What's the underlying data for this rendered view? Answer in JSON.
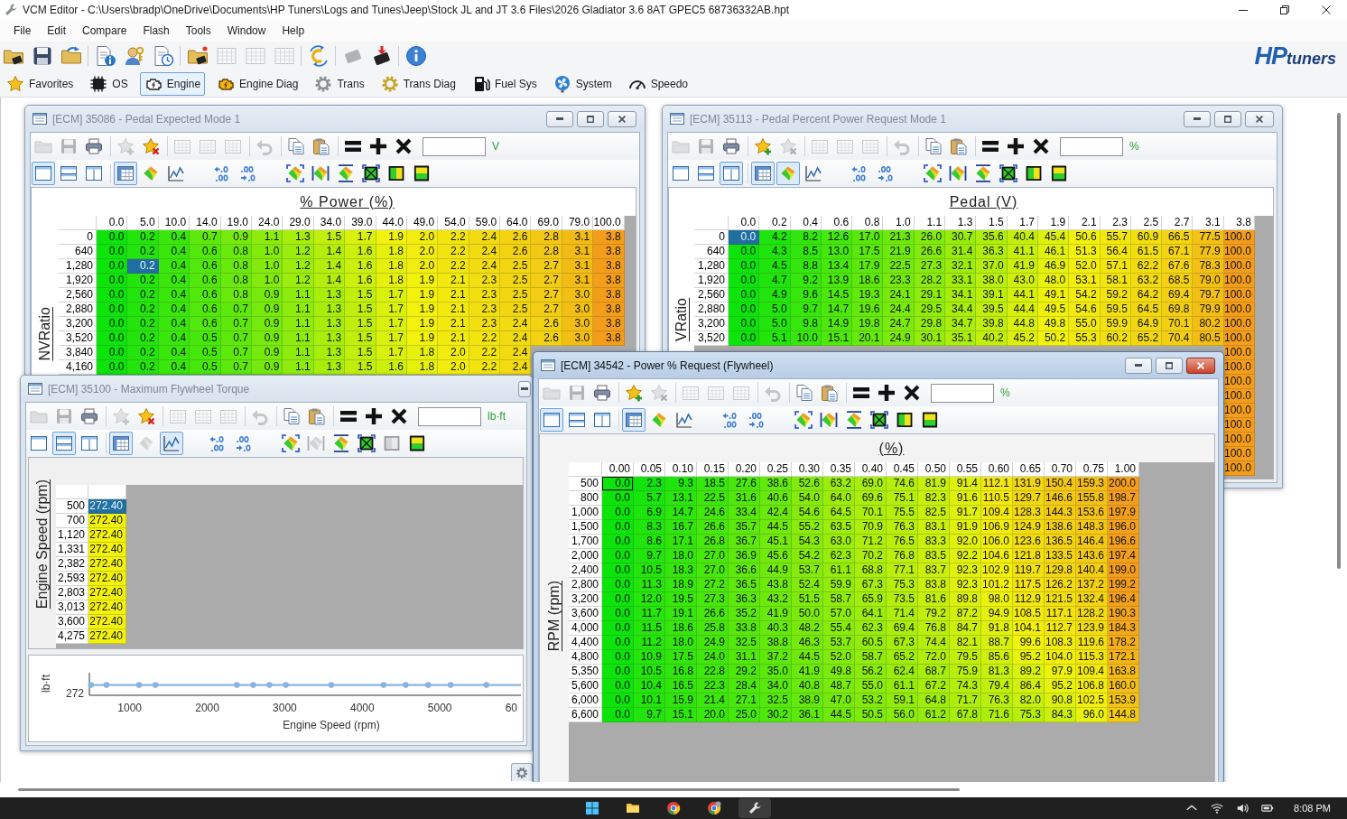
{
  "window": {
    "title": "VCM Editor - C:\\Users\\bradp\\OneDrive\\Documents\\HP Tuners\\Logs and Tunes\\Jeep\\Stock JL and JT 3.6 Files\\2026 Gladiator 3.6 8AT GPEC5 68736332AB.hpt"
  },
  "menu": [
    "File",
    "Edit",
    "Compare",
    "Flash",
    "Tools",
    "Window",
    "Help"
  ],
  "main_toolbar": [
    {
      "kind": "open-file",
      "disabled": false
    },
    {
      "kind": "save",
      "disabled": false
    },
    {
      "kind": "open-folder",
      "disabled": false
    },
    {
      "kind": "file-info",
      "disabled": false
    },
    {
      "kind": "user-key",
      "disabled": false
    },
    {
      "kind": "file-history",
      "disabled": false
    },
    {
      "kind": "open-device",
      "disabled": false
    },
    {
      "kind": "table",
      "disabled": true
    },
    {
      "kind": "table",
      "disabled": true
    },
    {
      "kind": "table",
      "disabled": true
    },
    {
      "kind": "compare",
      "disabled": false
    },
    {
      "kind": "chip-read",
      "disabled": true
    },
    {
      "kind": "chip-write",
      "disabled": false
    },
    {
      "kind": "info",
      "disabled": false
    }
  ],
  "logo": {
    "initials": "HP",
    "word": "tuners"
  },
  "nav_tabs": [
    {
      "kind": "favorites",
      "label": "Favorites",
      "selected": false
    },
    {
      "kind": "os",
      "label": "OS",
      "selected": false
    },
    {
      "kind": "engine",
      "label": "Engine",
      "selected": true
    },
    {
      "kind": "engine-diag",
      "label": "Engine Diag",
      "selected": false
    },
    {
      "kind": "trans",
      "label": "Trans",
      "selected": false
    },
    {
      "kind": "trans-diag",
      "label": "Trans Diag",
      "selected": false
    },
    {
      "kind": "fuel",
      "label": "Fuel Sys",
      "selected": false
    },
    {
      "kind": "system",
      "label": "System",
      "selected": false
    },
    {
      "kind": "speedo",
      "label": "Speedo",
      "selected": false
    }
  ],
  "editor_windows": [
    {
      "kind": "map",
      "title": "[ECM] 35086 - Pedal Expected Mode 1",
      "active": false,
      "toolbar": [
        {
          "kind": "open",
          "disabled": true
        },
        {
          "kind": "save",
          "disabled": true
        },
        {
          "kind": "print",
          "disabled": false
        },
        {
          "kind": "favorite-add",
          "disabled": true
        },
        {
          "kind": "favorite-remove",
          "disabled": false
        },
        {
          "kind": "grid",
          "disabled": true
        },
        {
          "kind": "grid",
          "disabled": true
        },
        {
          "kind": "grid",
          "disabled": true
        },
        {
          "kind": "undo",
          "disabled": true
        },
        {
          "kind": "copy",
          "disabled": false
        },
        {
          "kind": "paste",
          "disabled": false
        },
        {
          "kind": "set",
          "disabled": false
        },
        {
          "kind": "add",
          "disabled": false
        },
        {
          "kind": "multiply",
          "disabled": false
        }
      ],
      "unit": "V",
      "view_toolbar": [
        {
          "kind": "single-view",
          "pressed": true,
          "disabled": false
        },
        {
          "kind": "horizontal-split",
          "pressed": false,
          "disabled": false
        },
        {
          "kind": "vertical-split",
          "pressed": false,
          "disabled": false
        },
        {
          "kind": "table-view",
          "pressed": true,
          "disabled": false
        },
        {
          "kind": "surface-view",
          "pressed": false,
          "disabled": false
        },
        {
          "kind": "graph-view",
          "pressed": false,
          "disabled": false
        },
        {
          "kind": "decimals-fewer",
          "pressed": false,
          "disabled": false
        },
        {
          "kind": "decimals-more",
          "pressed": false,
          "disabled": false
        },
        {
          "kind": "smooth",
          "pressed": false,
          "disabled": false
        },
        {
          "kind": "interpolate-horizontal",
          "pressed": false,
          "disabled": false
        },
        {
          "kind": "interpolate-vertical",
          "pressed": false,
          "disabled": false
        },
        {
          "kind": "fill",
          "pressed": false,
          "disabled": false
        },
        {
          "kind": "interpolate-columns",
          "pressed": false,
          "disabled": false
        },
        {
          "kind": "interpolate-rows",
          "pressed": false,
          "disabled": false
        }
      ],
      "column_axis_title": "% Power (%)",
      "row_axis_title": "NVRatio",
      "columns": [
        {
          "label": "0.0",
          "selected": false
        },
        {
          "label": "5.0",
          "selected": true
        },
        {
          "label": "10.0",
          "selected": false
        },
        {
          "label": "14.0",
          "selected": false
        },
        {
          "label": "19.0",
          "selected": false
        },
        {
          "label": "24.0",
          "selected": false
        },
        {
          "label": "29.0",
          "selected": false
        },
        {
          "label": "34.0",
          "selected": false
        },
        {
          "label": "39.0",
          "selected": false
        },
        {
          "label": "44.0",
          "selected": false
        },
        {
          "label": "49.0",
          "selected": false
        },
        {
          "label": "54.0",
          "selected": false
        },
        {
          "label": "59.0",
          "selected": false
        },
        {
          "label": "64.0",
          "selected": false
        },
        {
          "label": "69.0",
          "selected": false
        },
        {
          "label": "79.0",
          "selected": false
        },
        {
          "label": "100.0",
          "selected": false
        }
      ],
      "rows": [
        {
          "label": "0",
          "selected": false,
          "cells": [
            "0.0",
            "0.2",
            "0.4",
            "0.7",
            "0.9",
            "1.1",
            "1.3",
            "1.5",
            "1.7",
            "1.9",
            "2.0",
            "2.2",
            "2.4",
            "2.6",
            "2.8",
            "3.1",
            "3.8"
          ]
        },
        {
          "label": "640",
          "selected": false,
          "cells": [
            "0.0",
            "0.2",
            "0.4",
            "0.6",
            "0.8",
            "1.0",
            "1.2",
            "1.4",
            "1.6",
            "1.8",
            "2.0",
            "2.2",
            "2.4",
            "2.6",
            "2.8",
            "3.1",
            "3.8"
          ]
        },
        {
          "label": "1,280",
          "selected": true,
          "cells": [
            "0.0",
            "0.2",
            "0.4",
            "0.6",
            "0.8",
            "1.0",
            "1.2",
            "1.4",
            "1.6",
            "1.8",
            "2.0",
            "2.2",
            "2.4",
            "2.5",
            "2.7",
            "3.1",
            "3.8"
          ]
        },
        {
          "label": "1,920",
          "selected": false,
          "cells": [
            "0.0",
            "0.2",
            "0.4",
            "0.6",
            "0.8",
            "1.0",
            "1.2",
            "1.4",
            "1.6",
            "1.8",
            "1.9",
            "2.1",
            "2.3",
            "2.5",
            "2.7",
            "3.1",
            "3.8"
          ]
        },
        {
          "label": "2,560",
          "selected": false,
          "cells": [
            "0.0",
            "0.2",
            "0.4",
            "0.6",
            "0.8",
            "0.9",
            "1.1",
            "1.3",
            "1.5",
            "1.7",
            "1.9",
            "2.1",
            "2.3",
            "2.5",
            "2.7",
            "3.0",
            "3.8"
          ]
        },
        {
          "label": "2,880",
          "selected": false,
          "cells": [
            "0.0",
            "0.2",
            "0.4",
            "0.6",
            "0.7",
            "0.9",
            "1.1",
            "1.3",
            "1.5",
            "1.7",
            "1.9",
            "2.1",
            "2.3",
            "2.5",
            "2.7",
            "3.0",
            "3.8"
          ]
        },
        {
          "label": "3,200",
          "selected": false,
          "cells": [
            "0.0",
            "0.2",
            "0.4",
            "0.6",
            "0.7",
            "0.9",
            "1.1",
            "1.3",
            "1.5",
            "1.7",
            "1.9",
            "2.1",
            "2.3",
            "2.4",
            "2.6",
            "3.0",
            "3.8"
          ]
        },
        {
          "label": "3,520",
          "selected": false,
          "cells": [
            "0.0",
            "0.2",
            "0.4",
            "0.5",
            "0.7",
            "0.9",
            "1.1",
            "1.3",
            "1.5",
            "1.7",
            "1.9",
            "2.1",
            "2.2",
            "2.4",
            "2.6",
            "3.0",
            "3.8"
          ]
        },
        {
          "label": "3,840",
          "selected": false,
          "cells": [
            "0.0",
            "0.2",
            "0.4",
            "0.5",
            "0.7",
            "0.9",
            "1.1",
            "1.3",
            "1.5",
            "1.7",
            "1.8",
            "2.0",
            "2.2",
            "2.4"
          ]
        },
        {
          "label": "4,160",
          "selected": false,
          "cells": [
            "0.0",
            "0.2",
            "0.4",
            "0.5",
            "0.7",
            "0.9",
            "1.1",
            "1.3",
            "1.5",
            "1.6",
            "1.8",
            "2.0",
            "2.2",
            "2.4"
          ]
        }
      ]
    },
    {
      "kind": "map",
      "title": "[ECM] 35113 - Pedal Percent Power Request Mode 1",
      "active": false,
      "toolbar": [
        {
          "kind": "open",
          "disabled": true
        },
        {
          "kind": "save",
          "disabled": true
        },
        {
          "kind": "print",
          "disabled": false
        },
        {
          "kind": "favorite-add",
          "disabled": false
        },
        {
          "kind": "favorite-remove",
          "disabled": true
        },
        {
          "kind": "grid",
          "disabled": true
        },
        {
          "kind": "grid",
          "disabled": true
        },
        {
          "kind": "grid",
          "disabled": true
        },
        {
          "kind": "undo",
          "disabled": true
        },
        {
          "kind": "copy",
          "disabled": false
        },
        {
          "kind": "paste",
          "disabled": false
        },
        {
          "kind": "set",
          "disabled": false
        },
        {
          "kind": "add",
          "disabled": false
        },
        {
          "kind": "multiply",
          "disabled": false
        }
      ],
      "unit": "%",
      "view_toolbar": [
        {
          "kind": "single-view",
          "pressed": false,
          "disabled": false
        },
        {
          "kind": "horizontal-split",
          "pressed": false,
          "disabled": false
        },
        {
          "kind": "vertical-split",
          "pressed": true,
          "disabled": false
        },
        {
          "kind": "table-view",
          "pressed": true,
          "disabled": false
        },
        {
          "kind": "surface-view",
          "pressed": true,
          "disabled": false
        },
        {
          "kind": "graph-view",
          "pressed": false,
          "disabled": false
        },
        {
          "kind": "decimals-fewer",
          "pressed": false,
          "disabled": false
        },
        {
          "kind": "decimals-more",
          "pressed": false,
          "disabled": false
        },
        {
          "kind": "smooth",
          "pressed": false,
          "disabled": false
        },
        {
          "kind": "interpolate-horizontal",
          "pressed": false,
          "disabled": false
        },
        {
          "kind": "interpolate-vertical",
          "pressed": false,
          "disabled": false
        },
        {
          "kind": "fill",
          "pressed": false,
          "disabled": false
        },
        {
          "kind": "interpolate-columns",
          "pressed": false,
          "disabled": false
        },
        {
          "kind": "interpolate-rows",
          "pressed": false,
          "disabled": false
        }
      ],
      "column_axis_title": "Pedal (V)",
      "row_axis_title": "VRatio",
      "columns": [
        {
          "label": "0.0",
          "selected": true
        },
        {
          "label": "0.2",
          "selected": false
        },
        {
          "label": "0.4",
          "selected": false
        },
        {
          "label": "0.6",
          "selected": false
        },
        {
          "label": "0.8",
          "selected": false
        },
        {
          "label": "1.0",
          "selected": false
        },
        {
          "label": "1.1",
          "selected": false
        },
        {
          "label": "1.3",
          "selected": false
        },
        {
          "label": "1.5",
          "selected": false
        },
        {
          "label": "1.7",
          "selected": false
        },
        {
          "label": "1.9",
          "selected": false
        },
        {
          "label": "2.1",
          "selected": false
        },
        {
          "label": "2.3",
          "selected": false
        },
        {
          "label": "2.5",
          "selected": false
        },
        {
          "label": "2.7",
          "selected": false
        },
        {
          "label": "3.1",
          "selected": false
        },
        {
          "label": "3.8",
          "selected": false
        }
      ],
      "rows": [
        {
          "label": "0",
          "selected": true,
          "cells": [
            "0.0",
            "4.2",
            "8.2",
            "12.6",
            "17.0",
            "21.3",
            "26.0",
            "30.7",
            "35.6",
            "40.4",
            "45.4",
            "50.6",
            "55.7",
            "60.9",
            "66.5",
            "77.5",
            "100.0"
          ]
        },
        {
          "label": "640",
          "selected": false,
          "cells": [
            "0.0",
            "4.3",
            "8.5",
            "13.0",
            "17.5",
            "21.9",
            "26.6",
            "31.4",
            "36.3",
            "41.1",
            "46.1",
            "51.3",
            "56.4",
            "61.5",
            "67.1",
            "77.9",
            "100.0"
          ]
        },
        {
          "label": "1,280",
          "selected": false,
          "cells": [
            "0.0",
            "4.5",
            "8.8",
            "13.4",
            "17.9",
            "22.5",
            "27.3",
            "32.1",
            "37.0",
            "41.9",
            "46.9",
            "52.0",
            "57.1",
            "62.2",
            "67.6",
            "78.3",
            "100.0"
          ]
        },
        {
          "label": "1,920",
          "selected": false,
          "cells": [
            "0.0",
            "4.7",
            "9.2",
            "13.9",
            "18.6",
            "23.3",
            "28.2",
            "33.1",
            "38.0",
            "43.0",
            "48.0",
            "53.1",
            "58.1",
            "63.2",
            "68.5",
            "79.0",
            "100.0"
          ]
        },
        {
          "label": "2,560",
          "selected": false,
          "cells": [
            "0.0",
            "4.9",
            "9.6",
            "14.5",
            "19.3",
            "24.1",
            "29.1",
            "34.1",
            "39.1",
            "44.1",
            "49.1",
            "54.2",
            "59.2",
            "64.2",
            "69.4",
            "79.7",
            "100.0"
          ]
        },
        {
          "label": "2,880",
          "selected": false,
          "cells": [
            "0.0",
            "5.0",
            "9.7",
            "14.7",
            "19.6",
            "24.4",
            "29.5",
            "34.4",
            "39.5",
            "44.4",
            "49.5",
            "54.6",
            "59.5",
            "64.5",
            "69.8",
            "79.9",
            "100.0"
          ]
        },
        {
          "label": "3,200",
          "selected": false,
          "cells": [
            "0.0",
            "5.0",
            "9.8",
            "14.9",
            "19.8",
            "24.7",
            "29.8",
            "34.7",
            "39.8",
            "44.8",
            "49.8",
            "55.0",
            "59.9",
            "64.9",
            "70.1",
            "80.2",
            "100.0"
          ]
        },
        {
          "label": "3,520",
          "selected": false,
          "cells": [
            "0.0",
            "5.1",
            "10.0",
            "15.1",
            "20.1",
            "24.9",
            "30.1",
            "35.1",
            "40.2",
            "45.2",
            "50.2",
            "55.3",
            "60.2",
            "65.2",
            "70.4",
            "80.5",
            "100.0"
          ]
        }
      ],
      "covered_rows_last_column": [
        "100.0",
        "100.0",
        "100.0",
        "100.0",
        "100.0",
        "100.0",
        "100.0",
        "100.0",
        "100.0"
      ]
    },
    {
      "kind": "curve",
      "title": "[ECM] 35100 - Maximum Flywheel Torque",
      "active": false,
      "toolbar": [
        {
          "kind": "open",
          "disabled": true
        },
        {
          "kind": "save",
          "disabled": true
        },
        {
          "kind": "print",
          "disabled": false
        },
        {
          "kind": "favorite-add",
          "disabled": true
        },
        {
          "kind": "favorite-remove",
          "disabled": false
        },
        {
          "kind": "grid",
          "disabled": true
        },
        {
          "kind": "grid",
          "disabled": true
        },
        {
          "kind": "grid",
          "disabled": true
        },
        {
          "kind": "undo",
          "disabled": true
        },
        {
          "kind": "copy",
          "disabled": false
        },
        {
          "kind": "paste",
          "disabled": false
        },
        {
          "kind": "set",
          "disabled": false
        },
        {
          "kind": "add",
          "disabled": false
        },
        {
          "kind": "multiply",
          "disabled": false
        }
      ],
      "unit": "lb·ft",
      "view_toolbar": [
        {
          "kind": "single-view",
          "pressed": false,
          "disabled": false
        },
        {
          "kind": "horizontal-split",
          "pressed": true,
          "disabled": false
        },
        {
          "kind": "vertical-split",
          "pressed": false,
          "disabled": false
        },
        {
          "kind": "table-view",
          "pressed": true,
          "disabled": false
        },
        {
          "kind": "surface-view",
          "pressed": false,
          "disabled": true
        },
        {
          "kind": "graph-view",
          "pressed": true,
          "disabled": false
        },
        {
          "kind": "decimals-fewer",
          "pressed": false,
          "disabled": false
        },
        {
          "kind": "decimals-more",
          "pressed": false,
          "disabled": false
        },
        {
          "kind": "smooth",
          "pressed": false,
          "disabled": false
        },
        {
          "kind": "interpolate-horizontal",
          "pressed": false,
          "disabled": true
        },
        {
          "kind": "interpolate-vertical",
          "pressed": false,
          "disabled": false
        },
        {
          "kind": "fill",
          "pressed": false,
          "disabled": false
        },
        {
          "kind": "interpolate-columns",
          "pressed": false,
          "disabled": true
        },
        {
          "kind": "interpolate-rows",
          "pressed": false,
          "disabled": false
        }
      ],
      "row_axis_title": "Engine Speed (rpm)",
      "rows": [
        {
          "label": "500",
          "value": "272.40",
          "selected": true
        },
        {
          "label": "700",
          "value": "272.40",
          "selected": false
        },
        {
          "label": "1,120",
          "value": "272.40",
          "selected": false
        },
        {
          "label": "1,331",
          "value": "272.40",
          "selected": false
        },
        {
          "label": "2,382",
          "value": "272.40",
          "selected": false
        },
        {
          "label": "2,593",
          "value": "272.40",
          "selected": false
        },
        {
          "label": "2,803",
          "value": "272.40",
          "selected": false
        },
        {
          "label": "3,013",
          "value": "272.40",
          "selected": false
        },
        {
          "label": "3,600",
          "value": "272.40",
          "selected": false
        },
        {
          "label": "4,275",
          "value": "272.40",
          "selected": false
        }
      ],
      "graph": {
        "y_title": "lb·ft",
        "y_label": "272",
        "x_labels": [
          "1000",
          "2000",
          "3000",
          "4000",
          "5000",
          "60"
        ],
        "x_title": "Engine Speed (rpm)"
      }
    },
    {
      "kind": "map",
      "title": "[ECM] 34542 - Power % Request (Flywheel)",
      "active": true,
      "toolbar": [
        {
          "kind": "open",
          "disabled": true
        },
        {
          "kind": "save",
          "disabled": true
        },
        {
          "kind": "print",
          "disabled": false
        },
        {
          "kind": "favorite-add",
          "disabled": false
        },
        {
          "kind": "favorite-remove",
          "disabled": true
        },
        {
          "kind": "grid",
          "disabled": true
        },
        {
          "kind": "grid",
          "disabled": true
        },
        {
          "kind": "grid",
          "disabled": true
        },
        {
          "kind": "undo",
          "disabled": true
        },
        {
          "kind": "copy",
          "disabled": false
        },
        {
          "kind": "paste",
          "disabled": false
        },
        {
          "kind": "set",
          "disabled": false
        },
        {
          "kind": "add",
          "disabled": false
        },
        {
          "kind": "multiply",
          "disabled": false
        }
      ],
      "unit": "%",
      "view_toolbar": [
        {
          "kind": "single-view",
          "pressed": true,
          "disabled": false
        },
        {
          "kind": "horizontal-split",
          "pressed": false,
          "disabled": false
        },
        {
          "kind": "vertical-split",
          "pressed": false,
          "disabled": false
        },
        {
          "kind": "table-view",
          "pressed": true,
          "disabled": false
        },
        {
          "kind": "surface-view",
          "pressed": false,
          "disabled": false
        },
        {
          "kind": "graph-view",
          "pressed": false,
          "disabled": false
        },
        {
          "kind": "decimals-fewer",
          "pressed": false,
          "disabled": false
        },
        {
          "kind": "decimals-more",
          "pressed": false,
          "disabled": false
        },
        {
          "kind": "smooth",
          "pressed": false,
          "disabled": false
        },
        {
          "kind": "interpolate-horizontal",
          "pressed": false,
          "disabled": false
        },
        {
          "kind": "interpolate-vertical",
          "pressed": false,
          "disabled": false
        },
        {
          "kind": "fill",
          "pressed": false,
          "disabled": false
        },
        {
          "kind": "interpolate-columns",
          "pressed": false,
          "disabled": false
        },
        {
          "kind": "interpolate-rows",
          "pressed": false,
          "disabled": false
        }
      ],
      "column_axis_title": "(%)",
      "row_axis_title": "RPM (rpm)",
      "columns": [
        {
          "label": "0.00",
          "selected": true
        },
        {
          "label": "0.05",
          "selected": false
        },
        {
          "label": "0.10",
          "selected": false
        },
        {
          "label": "0.15",
          "selected": false
        },
        {
          "label": "0.20",
          "selected": false
        },
        {
          "label": "0.25",
          "selected": false
        },
        {
          "label": "0.30",
          "selected": false
        },
        {
          "label": "0.35",
          "selected": false
        },
        {
          "label": "0.40",
          "selected": false
        },
        {
          "label": "0.45",
          "selected": false
        },
        {
          "label": "0.50",
          "selected": false
        },
        {
          "label": "0.55",
          "selected": false
        },
        {
          "label": "0.60",
          "selected": false
        },
        {
          "label": "0.65",
          "selected": false
        },
        {
          "label": "0.70",
          "selected": false
        },
        {
          "label": "0.75",
          "selected": false
        },
        {
          "label": "1.00",
          "selected": false
        }
      ],
      "rows": [
        {
          "label": "500",
          "selected": true,
          "cells": [
            "0.0",
            "2.3",
            "9.3",
            "18.5",
            "27.6",
            "38.6",
            "52.6",
            "63.2",
            "69.0",
            "74.6",
            "81.9",
            "91.4",
            "112.1",
            "131.9",
            "150.4",
            "159.3",
            "200.0"
          ]
        },
        {
          "label": "800",
          "selected": false,
          "cells": [
            "0.0",
            "5.7",
            "13.1",
            "22.5",
            "31.6",
            "40.6",
            "54.0",
            "64.0",
            "69.6",
            "75.1",
            "82.3",
            "91.6",
            "110.5",
            "129.7",
            "146.6",
            "155.8",
            "198.7"
          ]
        },
        {
          "label": "1,000",
          "selected": false,
          "cells": [
            "0.0",
            "6.9",
            "14.7",
            "24.6",
            "33.4",
            "42.4",
            "54.6",
            "64.5",
            "70.1",
            "75.5",
            "82.5",
            "91.7",
            "109.4",
            "128.3",
            "144.3",
            "153.6",
            "197.9"
          ]
        },
        {
          "label": "1,500",
          "selected": false,
          "cells": [
            "0.0",
            "8.3",
            "16.7",
            "26.6",
            "35.7",
            "44.5",
            "55.2",
            "63.5",
            "70.9",
            "76.3",
            "83.1",
            "91.9",
            "106.9",
            "124.9",
            "138.6",
            "148.3",
            "196.0"
          ]
        },
        {
          "label": "1,700",
          "selected": false,
          "cells": [
            "0.0",
            "8.6",
            "17.1",
            "26.8",
            "36.7",
            "45.1",
            "54.3",
            "63.0",
            "71.2",
            "76.5",
            "83.3",
            "92.0",
            "106.0",
            "123.6",
            "136.5",
            "146.4",
            "196.6"
          ]
        },
        {
          "label": "2,000",
          "selected": false,
          "cells": [
            "0.0",
            "9.7",
            "18.0",
            "27.0",
            "36.9",
            "45.6",
            "54.2",
            "62.3",
            "70.2",
            "76.8",
            "83.5",
            "92.2",
            "104.6",
            "121.8",
            "133.5",
            "143.6",
            "197.4"
          ]
        },
        {
          "label": "2,400",
          "selected": false,
          "cells": [
            "0.0",
            "10.5",
            "18.3",
            "27.0",
            "36.6",
            "44.9",
            "53.7",
            "61.1",
            "68.8",
            "77.1",
            "83.7",
            "92.3",
            "102.9",
            "119.7",
            "129.8",
            "140.4",
            "199.0"
          ]
        },
        {
          "label": "2,800",
          "selected": false,
          "cells": [
            "0.0",
            "11.3",
            "18.9",
            "27.2",
            "36.5",
            "43.8",
            "52.4",
            "59.9",
            "67.3",
            "75.3",
            "83.8",
            "92.3",
            "101.2",
            "117.5",
            "126.2",
            "137.2",
            "199.2"
          ]
        },
        {
          "label": "3,200",
          "selected": false,
          "cells": [
            "0.0",
            "12.0",
            "19.5",
            "27.3",
            "36.3",
            "43.2",
            "51.5",
            "58.7",
            "65.9",
            "73.5",
            "81.6",
            "89.8",
            "98.0",
            "112.9",
            "121.5",
            "132.4",
            "196.4"
          ]
        },
        {
          "label": "3,600",
          "selected": false,
          "cells": [
            "0.0",
            "11.7",
            "19.1",
            "26.6",
            "35.2",
            "41.9",
            "50.0",
            "57.0",
            "64.1",
            "71.4",
            "79.2",
            "87.2",
            "94.9",
            "108.5",
            "117.1",
            "128.2",
            "190.3"
          ]
        },
        {
          "label": "4,000",
          "selected": false,
          "cells": [
            "0.0",
            "11.5",
            "18.6",
            "25.8",
            "33.8",
            "40.3",
            "48.2",
            "55.4",
            "62.3",
            "69.4",
            "76.8",
            "84.7",
            "91.8",
            "104.1",
            "112.7",
            "123.9",
            "184.3"
          ]
        },
        {
          "label": "4,400",
          "selected": false,
          "cells": [
            "0.0",
            "11.2",
            "18.0",
            "24.9",
            "32.5",
            "38.8",
            "46.3",
            "53.7",
            "60.5",
            "67.3",
            "74.4",
            "82.1",
            "88.7",
            "99.6",
            "108.3",
            "119.6",
            "178.2"
          ]
        },
        {
          "label": "4,800",
          "selected": false,
          "cells": [
            "0.0",
            "10.9",
            "17.5",
            "24.0",
            "31.1",
            "37.2",
            "44.5",
            "52.0",
            "58.7",
            "65.2",
            "72.0",
            "79.5",
            "85.6",
            "95.2",
            "104.0",
            "115.3",
            "172.1"
          ]
        },
        {
          "label": "5,350",
          "selected": false,
          "cells": [
            "0.0",
            "10.5",
            "16.8",
            "22.8",
            "29.2",
            "35.0",
            "41.9",
            "49.8",
            "56.2",
            "62.4",
            "68.7",
            "75.9",
            "81.3",
            "89.2",
            "97.9",
            "109.4",
            "163.8"
          ]
        },
        {
          "label": "5,600",
          "selected": false,
          "cells": [
            "0.0",
            "10.4",
            "16.5",
            "22.3",
            "28.4",
            "34.0",
            "40.8",
            "48.7",
            "55.0",
            "61.1",
            "67.2",
            "74.3",
            "79.4",
            "86.4",
            "95.2",
            "106.8",
            "160.0"
          ]
        },
        {
          "label": "6,000",
          "selected": false,
          "cells": [
            "0.0",
            "10.1",
            "15.9",
            "21.4",
            "27.1",
            "32.5",
            "38.9",
            "47.0",
            "53.2",
            "59.1",
            "64.8",
            "71.7",
            "76.3",
            "82.0",
            "90.8",
            "102.5",
            "153.9"
          ]
        },
        {
          "label": "6,600",
          "selected": false,
          "cells": [
            "0.0",
            "9.7",
            "15.1",
            "20.0",
            "25.0",
            "30.2",
            "36.1",
            "44.5",
            "50.5",
            "56.0",
            "61.2",
            "67.8",
            "71.6",
            "75.3",
            "84.3",
            "96.0",
            "144.8"
          ]
        }
      ]
    }
  ],
  "taskbar": {
    "apps": [
      {
        "kind": "start",
        "active": false
      },
      {
        "kind": "files",
        "active": false
      },
      {
        "kind": "browser",
        "active": false
      },
      {
        "kind": "browser-profile",
        "active": false
      },
      {
        "kind": "editor",
        "active": true
      }
    ],
    "clock": "8:08 PM"
  }
}
